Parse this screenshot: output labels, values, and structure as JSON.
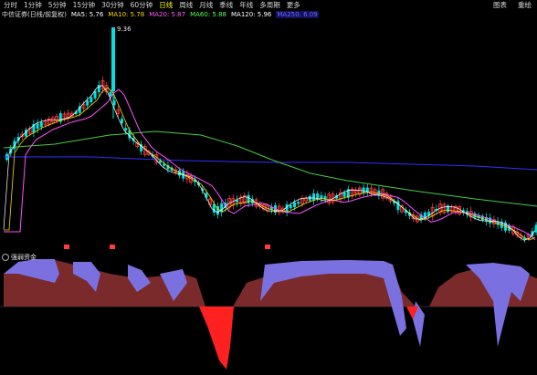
{
  "toolbar": {
    "items": [
      "分时",
      "1分钟",
      "5分钟",
      "15分钟",
      "30分钟",
      "60分钟",
      "日线",
      "周线",
      "月线",
      "季线",
      "年线",
      "多周期",
      "更多"
    ],
    "right_items": [
      "图表",
      "重绘"
    ]
  },
  "indicator_bar": {
    "title": "中信证券(日线/前复权)",
    "ma5": "MA5: 5.76",
    "ma10": "MA10: 5.78",
    "ma20": "MA20: 5.87",
    "ma60": "MA60: 5.88",
    "ma120": "MA120: 5.96",
    "ma250": "MA250: 6.09"
  },
  "price_annotation": "9.36",
  "subchart": {
    "title": "强弱资金"
  },
  "colors": {
    "up": "#ff3c3c",
    "down": "#00e0e0",
    "ma_white": "#ffffff",
    "ma_yellow": "#ffd700",
    "ma_magenta": "#ff50ff",
    "ma_green": "#44cc44",
    "ma_blue": "#3030ff",
    "area_red": "#7a2a2a",
    "area_purple": "#7a70e0",
    "neg_red": "#ff2020"
  }
}
